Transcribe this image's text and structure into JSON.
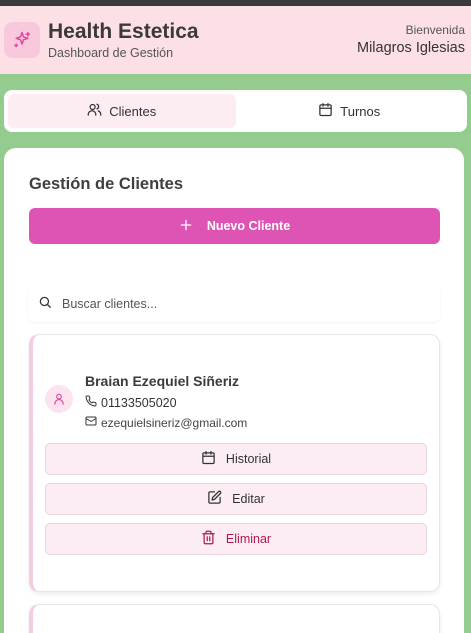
{
  "header": {
    "app_title": "Health Estetica",
    "app_subtitle": "Dashboard de Gestión",
    "welcome_label": "Bienvenida",
    "user_name": "Milagros Iglesias",
    "logo_icon": "sparkles-icon"
  },
  "tabs": [
    {
      "label": "Clientes",
      "icon": "users-icon",
      "active": true
    },
    {
      "label": "Turnos",
      "icon": "calendar-icon",
      "active": false
    }
  ],
  "clients_section": {
    "title": "Gestión de Clientes",
    "new_button_label": "Nuevo Cliente",
    "search_placeholder": "Buscar clientes...",
    "search_value": ""
  },
  "clients": [
    {
      "name": "Braian Ezequiel Siñeriz",
      "phone": "01133505020",
      "email": "ezequielsineriz@gmail.com",
      "actions": {
        "history_label": "Historial",
        "edit_label": "Editar",
        "delete_label": "Eliminar"
      }
    }
  ],
  "colors": {
    "background": "#94cc8f",
    "header_bg": "#fde0e6",
    "accent": "#de54b4",
    "danger": "#b0184f",
    "action_bg": "#fcedf4"
  }
}
